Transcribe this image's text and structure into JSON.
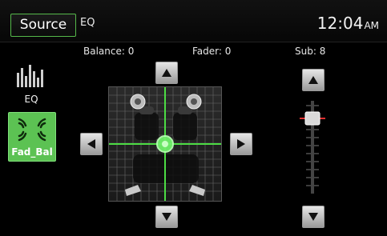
{
  "topbar": {
    "source_label": "Source",
    "mode_label": "EQ",
    "clock_time": "12:04",
    "clock_ampm": "AM"
  },
  "sidebar": {
    "items": [
      {
        "label": "EQ",
        "icon": "equalizer-icon",
        "active": false
      },
      {
        "label": "Fad_Bal",
        "icon": "speaker-balance-icon",
        "active": true
      }
    ]
  },
  "values": {
    "balance_label": "Balance:",
    "balance_value": "0",
    "fader_label": "Fader:",
    "fader_value": "0",
    "sub_label": "Sub:",
    "sub_value": "8"
  },
  "colors": {
    "accent": "#5cc253",
    "crosshair": "#4cdc44",
    "slider_marker": "#e03030"
  },
  "sub_level_fraction": 0.8
}
